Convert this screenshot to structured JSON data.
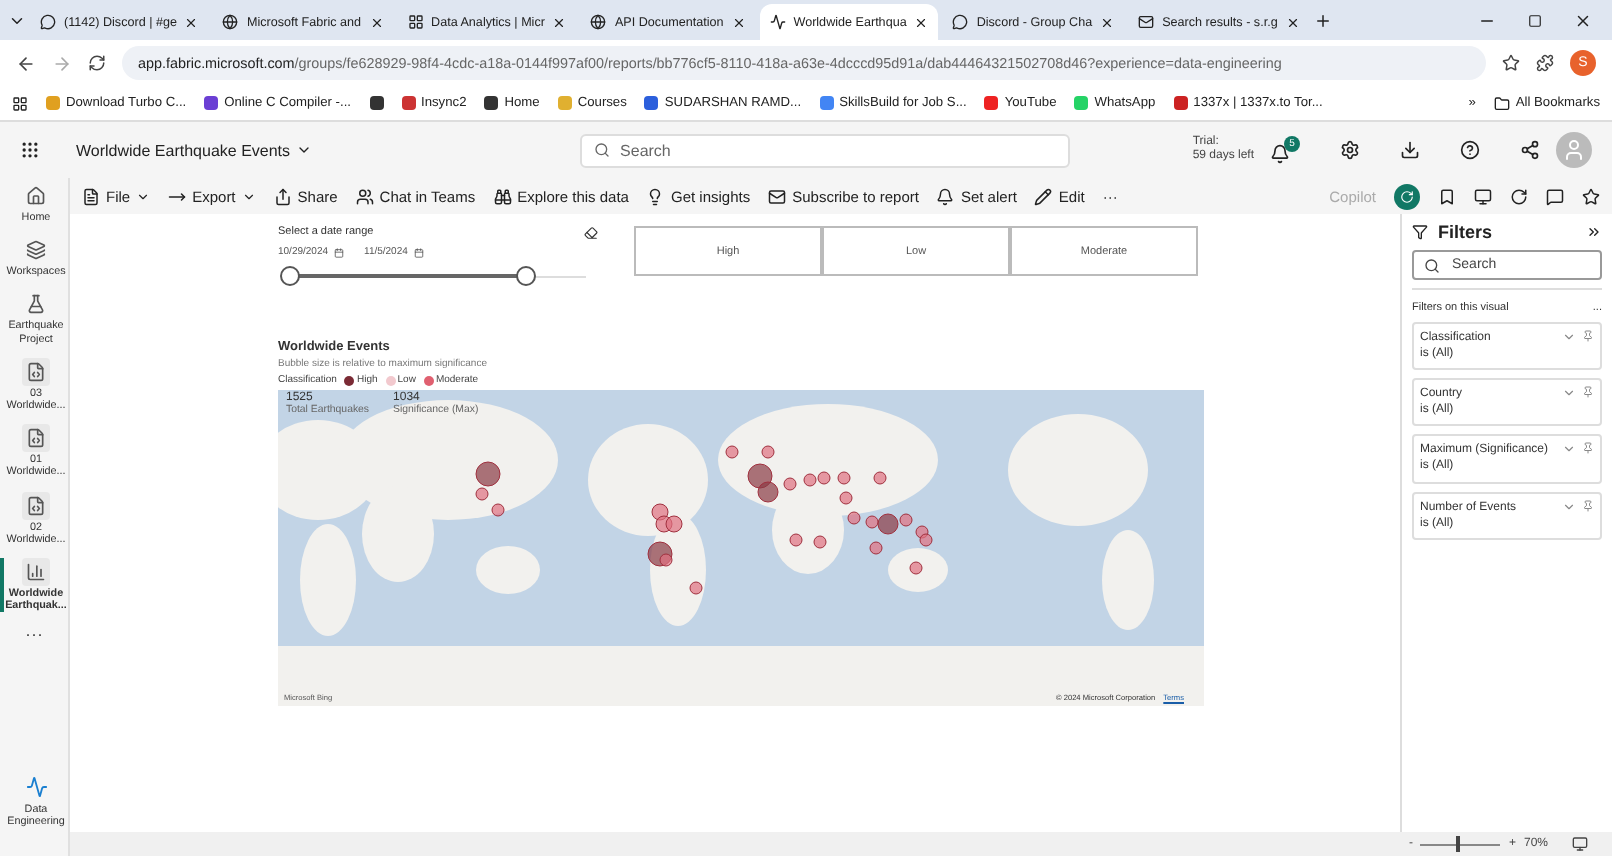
{
  "browser": {
    "tabs": [
      {
        "title": "(1142) Discord | #ge",
        "kind": "chat",
        "selected": false
      },
      {
        "title": "Microsoft Fabric and",
        "kind": "globe",
        "selected": false
      },
      {
        "title": "Data Analytics | Micr",
        "kind": "grid",
        "selected": false
      },
      {
        "title": "API Documentation",
        "kind": "globe",
        "selected": false
      },
      {
        "title": "Worldwide Earthqua",
        "kind": "wave",
        "selected": true
      },
      {
        "title": "Discord - Group Cha",
        "kind": "chat",
        "selected": false
      },
      {
        "title": "Search results - s.r.g",
        "kind": "mail",
        "selected": false
      }
    ],
    "url_host": "app.fabric.microsoft.com",
    "url_path": "/groups/fe628929-98f4-4cdc-a18a-0144f997af00/reports/bb776cf5-8110-418a-a63e-4dcccd95d91a/dab44464321502708d46?experience=data-engineering",
    "profile": "S",
    "bookmarks": [
      {
        "kind": "link",
        "label": "Download Turbo C..."
      },
      {
        "kind": "link",
        "label": "Online C Compiler -..."
      },
      {
        "kind": "icon"
      },
      {
        "kind": "link",
        "label": "Insync2"
      },
      {
        "kind": "link",
        "label": "Home"
      },
      {
        "kind": "link",
        "label": "Courses"
      },
      {
        "kind": "link",
        "label": "SUDARSHAN RAMD..."
      },
      {
        "kind": "link",
        "label": "SkillsBuild for Job S..."
      },
      {
        "kind": "link",
        "label": "YouTube"
      },
      {
        "kind": "link",
        "label": "WhatsApp"
      },
      {
        "kind": "link",
        "label": "1337x | 1337x.to Tor..."
      }
    ],
    "more_bookmarks": "»",
    "all_bookmarks": "All Bookmarks"
  },
  "header": {
    "report_title": "Worldwide Earthquake Events",
    "search_placeholder": "Search",
    "trial_label": "Trial:",
    "trial_days": "59 days left",
    "notifications": "5"
  },
  "toolbar": {
    "items": [
      {
        "label": "File",
        "menu": true
      },
      {
        "label": "Export",
        "menu": true
      },
      {
        "label": "Share",
        "menu": false
      },
      {
        "label": "Chat in Teams",
        "menu": false
      },
      {
        "label": "Explore this data",
        "menu": false
      },
      {
        "label": "Get insights",
        "menu": false
      },
      {
        "label": "Subscribe to report",
        "menu": false
      },
      {
        "label": "Set alert",
        "menu": false
      },
      {
        "label": "Edit",
        "menu": false
      }
    ],
    "more": "···",
    "copilot": {
      "label": "Copilot",
      "disabled": true
    }
  },
  "sidebar": {
    "items": [
      {
        "label": "Home",
        "kind": "home",
        "selected": false
      },
      {
        "label": "Workspaces",
        "kind": "workspaces",
        "selected": false
      },
      {
        "label": "Earthquake Project",
        "kind": "project",
        "selected": false
      },
      {
        "label": "03 Worldwide...",
        "kind": "notebook",
        "selected": false
      },
      {
        "label": "01 Worldwide...",
        "kind": "notebook",
        "selected": false
      },
      {
        "label": "02 Worldwide...",
        "kind": "notebook",
        "selected": false
      },
      {
        "label": "Worldwide Earthquak...",
        "kind": "report",
        "selected": true
      }
    ],
    "more": "···",
    "footer": "Data Engineering"
  },
  "slicer": {
    "title": "Select a date range",
    "start": "10/29/2024",
    "end": "11/5/2024",
    "level": 0.8
  },
  "classification_buttons": [
    {
      "label": "High",
      "selected": false
    },
    {
      "label": "Low",
      "selected": false
    },
    {
      "label": "Moderate",
      "selected": false
    }
  ],
  "visual": {
    "title": "Worldwide Events",
    "subtitle": "Bubble size is relative to maximum significance",
    "legend_title": "Classification",
    "legend": [
      {
        "label": "High",
        "color": "#7b2b35"
      },
      {
        "label": "Low",
        "color": "#f2c9ce"
      },
      {
        "label": "Moderate",
        "color": "#e06070"
      }
    ],
    "kpis": [
      {
        "value": "1525",
        "label": "Total Earthquakes"
      },
      {
        "value": "1034",
        "label": "Significance (Max)"
      }
    ],
    "map_credit": "Microsoft Bing",
    "copyright": "© 2024 Microsoft Corporation",
    "terms": "Terms"
  },
  "filters": {
    "title": "Filters",
    "search_placeholder": "Search",
    "section": "Filters on this visual",
    "section_more": "...",
    "cards": [
      {
        "name": "Classification",
        "value": "is (All)"
      },
      {
        "name": "Country",
        "value": "is (All)"
      },
      {
        "name": "Maximum (Significance)",
        "value": "is (All)"
      },
      {
        "name": "Number of Events",
        "value": "is (All)"
      }
    ]
  },
  "status_bar": {
    "minus": "-",
    "plus": "+",
    "zoom": "70%",
    "level": 0.45
  }
}
